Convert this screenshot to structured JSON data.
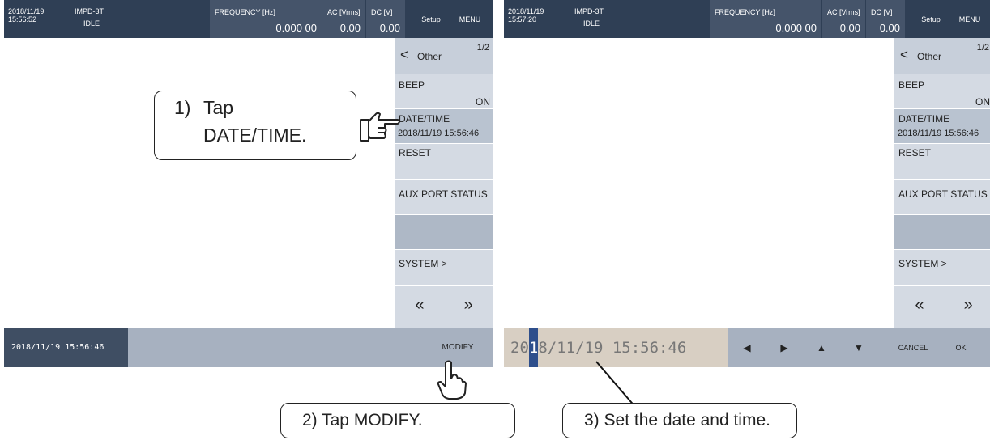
{
  "left_screen": {
    "header": {
      "date": "2018/11/19",
      "time": "15:56:52",
      "model": "IMPD-3T",
      "state": "IDLE",
      "frequency_label": "FREQUENCY [Hz]",
      "frequency_value": "0.000 00",
      "ac_label": "AC [Vrms]",
      "ac_value": "0.00",
      "dc_label": "DC [V]",
      "dc_value": "0.00",
      "setup_label": "Setup",
      "menu_label": "MENU"
    },
    "side_menu": {
      "back_icon": "chevron-left-icon",
      "back_glyph": "<",
      "title": "Other",
      "page": "1/2",
      "beep_label": "BEEP",
      "beep_value": "ON",
      "datetime_label": "DATE/TIME",
      "datetime_value": "2018/11/19 15:56:46",
      "reset_label": "RESET",
      "aux_label": "AUX PORT STATUS",
      "system_label": "SYSTEM >",
      "prev_glyph": "«",
      "next_glyph": "»"
    },
    "bottom": {
      "datetime": "2018/11/19 15:56:46",
      "modify_label": "MODIFY"
    }
  },
  "right_screen": {
    "header": {
      "date": "2018/11/19",
      "time": "15:57:20",
      "model": "IMPD-3T",
      "state": "IDLE",
      "frequency_label": "FREQUENCY [Hz]",
      "frequency_value": "0.000 00",
      "ac_label": "AC [Vrms]",
      "ac_value": "0.00",
      "dc_label": "DC [V]",
      "dc_value": "0.00",
      "setup_label": "Setup",
      "menu_label": "MENU"
    },
    "side_menu": {
      "back_icon": "chevron-left-icon",
      "back_glyph": "<",
      "title": "Other",
      "page": "1/2",
      "beep_label": "BEEP",
      "beep_value": "ON",
      "datetime_label": "DATE/TIME",
      "datetime_value": "2018/11/19 15:56:46",
      "reset_label": "RESET",
      "aux_label": "AUX PORT STATUS",
      "system_label": "SYSTEM >",
      "prev_glyph": "«",
      "next_glyph": "»"
    },
    "edit": {
      "value_before_cursor": "20",
      "cursor_char": "1",
      "value_after_cursor": "8/11/19 15:56:46",
      "left_glyph": "◀",
      "right_glyph": "▶",
      "up_glyph": "▲",
      "down_glyph": "▼",
      "cancel_label": "CANCEL",
      "ok_label": "OK"
    }
  },
  "callouts": {
    "step1_number": "1)",
    "step1_line1": "Tap",
    "step1_line2": "DATE/TIME.",
    "step2": "2) Tap MODIFY.",
    "step3": "3) Set the date and time."
  },
  "colors": {
    "topbar": "#2f3f55",
    "measure_panel": "#45546a",
    "side_menu": "#d4dae3",
    "selected_row": "#b9c3d0",
    "bottombar": "#a7b1c0",
    "edit_field": "#d8cfc3",
    "cursor": "#2e4f8c"
  }
}
